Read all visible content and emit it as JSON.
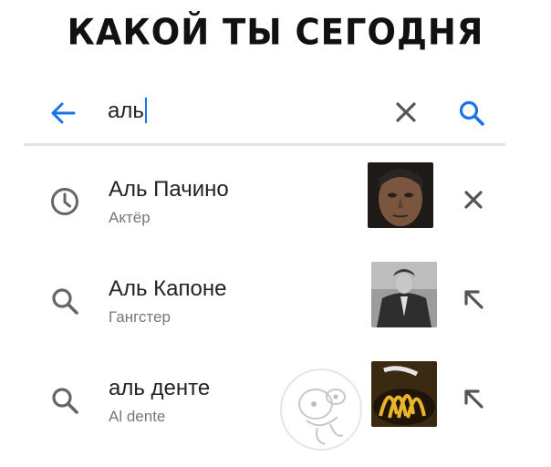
{
  "headline": "КАКОЙ ТЫ СЕГОДНЯ",
  "search": {
    "query": "аль",
    "back_icon": "arrow-left-icon",
    "clear_icon": "close-icon",
    "search_icon": "search-icon"
  },
  "suggestions": [
    {
      "title": "Аль Пачино",
      "subtitle": "Актёр",
      "leading_icon": "history-clock-icon",
      "thumbnail": "portrait-photo",
      "action_icon": "remove-icon"
    },
    {
      "title": "Аль Капоне",
      "subtitle": "Гангстер",
      "leading_icon": "search-icon",
      "thumbnail": "bw-suit-photo",
      "action_icon": "fill-query-arrow-icon"
    },
    {
      "title": "аль денте",
      "subtitle": "Al dente",
      "leading_icon": "search-icon",
      "thumbnail": "pasta-photo",
      "action_icon": "fill-query-arrow-icon"
    }
  ],
  "colors": {
    "accent": "#1a73e8",
    "icon_gray": "#666666",
    "divider": "#e2e2e2"
  }
}
